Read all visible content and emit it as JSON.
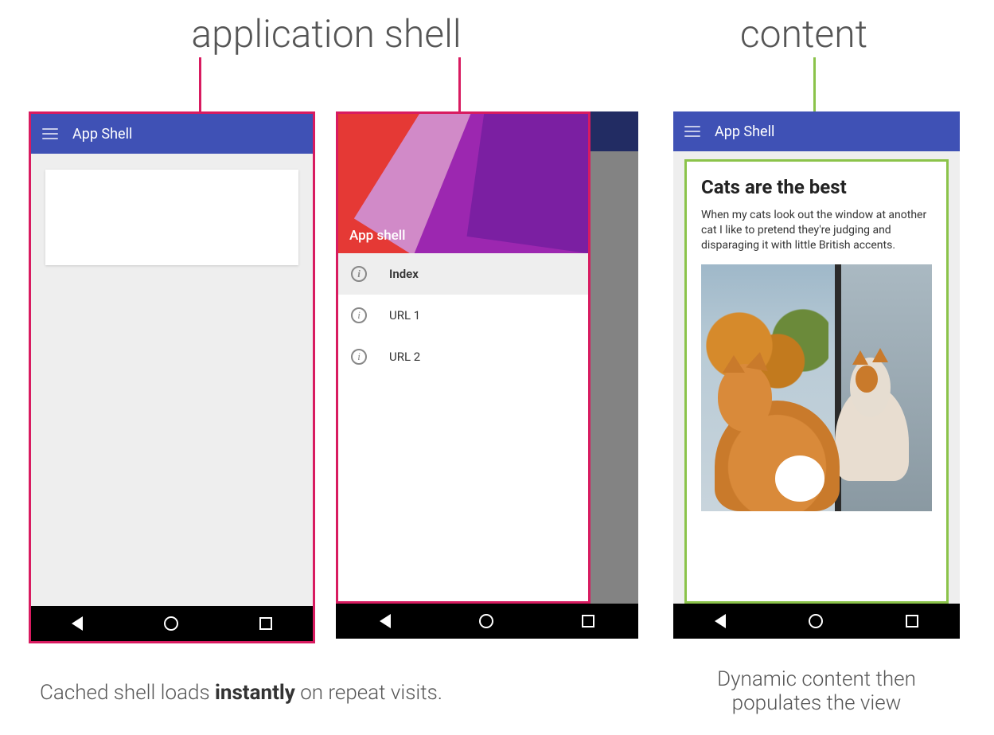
{
  "headings": {
    "left": "application shell",
    "right": "content"
  },
  "colors": {
    "pink": "#d81b60",
    "green": "#8bc34a",
    "appbar": "#3f51b5"
  },
  "phone1": {
    "title": "App Shell"
  },
  "phone2": {
    "drawer_title": "App shell",
    "items": [
      {
        "label": "Index",
        "active": true
      },
      {
        "label": "URL 1",
        "active": false
      },
      {
        "label": "URL 2",
        "active": false
      }
    ]
  },
  "phone3": {
    "title": "App Shell",
    "article": {
      "heading": "Cats are the best",
      "body": "When my cats look out the window at another cat I like to pretend they're judging and disparaging it with little British accents."
    }
  },
  "captions": {
    "left_pre": "Cached shell loads ",
    "left_bold": "instantly",
    "left_post": " on repeat visits.",
    "right": "Dynamic content then populates the view"
  }
}
